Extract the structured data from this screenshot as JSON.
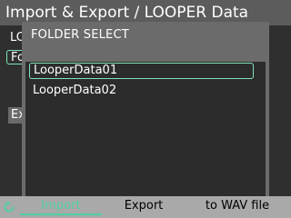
{
  "header": {
    "title": "Import & Export / LOOPER Data"
  },
  "background": {
    "label_partial": "LO",
    "field_partial": "Fo",
    "button_partial": "Ex"
  },
  "dialog": {
    "title": "FOLDER SELECT",
    "folders": [
      {
        "name": "LooperData01",
        "selected": true
      },
      {
        "name": "LooperData02",
        "selected": false
      }
    ]
  },
  "function_bar": {
    "back_icon": "return-arrow-icon",
    "buttons": [
      {
        "label": "Import",
        "active": true
      },
      {
        "label": "Export",
        "active": false
      },
      {
        "label": "to WAV file",
        "active": false
      }
    ]
  },
  "colors": {
    "accent": "#4fd0a0",
    "selection_border": "#7ee3b6"
  }
}
